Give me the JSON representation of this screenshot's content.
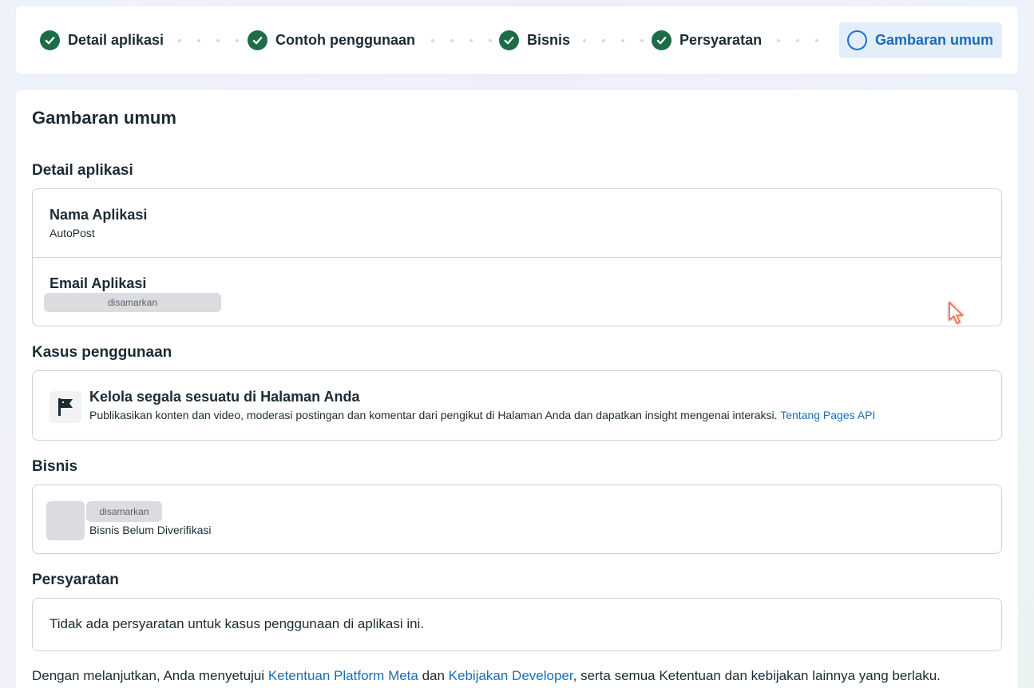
{
  "stepper": {
    "steps": [
      {
        "label": "Detail aplikasi",
        "status": "complete"
      },
      {
        "label": "Contoh penggunaan",
        "status": "complete"
      },
      {
        "label": "Bisnis",
        "status": "complete"
      },
      {
        "label": "Persyaratan",
        "status": "complete"
      },
      {
        "label": "Gambaran umum",
        "status": "current"
      }
    ]
  },
  "page": {
    "title": "Gambaran umum"
  },
  "app_details": {
    "section_title": "Detail aplikasi",
    "name_label": "Nama Aplikasi",
    "name_value": "AutoPost",
    "email_label": "Email Aplikasi",
    "email_value": "disamarkan"
  },
  "use_case": {
    "section_title": "Kasus penggunaan",
    "title": "Kelola segala sesuatu di Halaman Anda",
    "description": "Publikasikan konten dan video, moderasi postingan dan komentar dari pengikut di Halaman Anda dan dapatkan insight mengenai interaksi.",
    "link": "Tentang Pages API",
    "icon": "flag-icon"
  },
  "business": {
    "section_title": "Bisnis",
    "name": "disamarkan",
    "status": "Bisnis Belum Diverifikasi"
  },
  "requirements": {
    "section_title": "Persyaratan",
    "text": "Tidak ada persyaratan untuk kasus penggunaan di aplikasi ini."
  },
  "footer": {
    "text_before": "Dengan melanjutkan, Anda menyetujui ",
    "link1": "Ketentuan Platform Meta",
    "text_middle": " dan ",
    "link2": "Kebijakan Developer",
    "text_after": ", serta semua Ketentuan dan kebijakan lainnya yang berlaku."
  },
  "colors": {
    "complete": "#1e6b48",
    "active_text": "#1d69b5",
    "active_bg": "#e3eefb",
    "link": "#1a6eb8"
  }
}
